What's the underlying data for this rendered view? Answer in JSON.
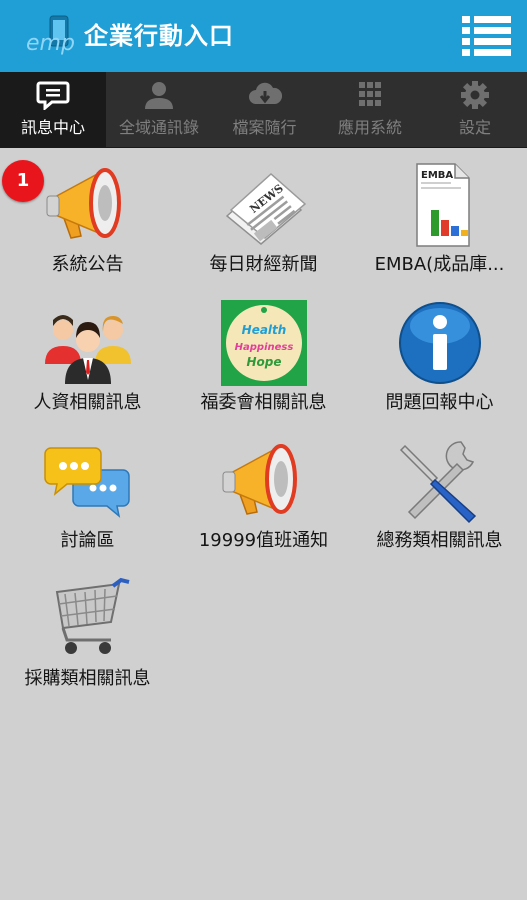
{
  "header": {
    "logo_text": "emp",
    "title": "企業行動入口",
    "menu_icon": "list-menu-icon",
    "bar_color": "#1f9fd6"
  },
  "tabs": [
    {
      "label": "訊息中心",
      "icon": "chat-bubble-icon",
      "active": true
    },
    {
      "label": "全域通訊錄",
      "icon": "person-icon",
      "active": false
    },
    {
      "label": "檔案隨行",
      "icon": "cloud-download-icon",
      "active": false
    },
    {
      "label": "應用系統",
      "icon": "grid-icon",
      "active": false
    },
    {
      "label": "設定",
      "icon": "gear-icon",
      "active": false
    }
  ],
  "tiles": [
    {
      "label": "系統公告",
      "icon": "megaphone-icon",
      "badge": "1"
    },
    {
      "label": "每日財經新聞",
      "icon": "newspaper-icon",
      "news_text": "NEWS"
    },
    {
      "label": "EMBA(成品庫...",
      "icon": "emba-report-icon",
      "doc_title": "EMBA"
    },
    {
      "label": "人資相關訊息",
      "icon": "people-group-icon"
    },
    {
      "label": "福委會相關訊息",
      "icon": "health-happiness-hope-icon",
      "logo_lines": [
        "Health",
        "Happiness",
        "Hope"
      ]
    },
    {
      "label": "問題回報中心",
      "icon": "info-icon"
    },
    {
      "label": "討論區",
      "icon": "chat-bubbles-icon"
    },
    {
      "label": "19999值班通知",
      "icon": "megaphone-icon"
    },
    {
      "label": "總務類相關訊息",
      "icon": "wrench-screwdriver-icon"
    },
    {
      "label": "採購類相關訊息",
      "icon": "shopping-cart-icon"
    }
  ]
}
